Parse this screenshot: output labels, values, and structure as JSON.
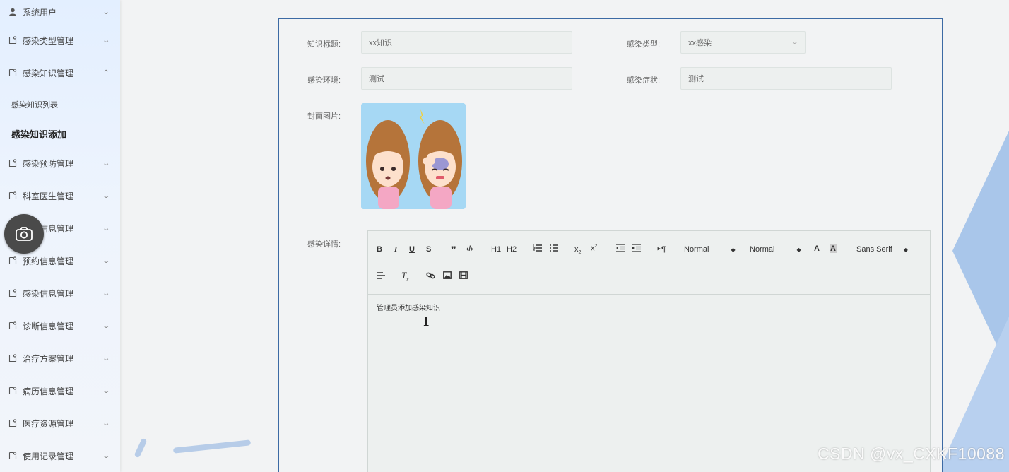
{
  "sidebar": {
    "items": [
      {
        "label": "系统用户",
        "icon": "user-icon"
      },
      {
        "label": "感染类型管理",
        "icon": "doc-icon"
      },
      {
        "label": "感染知识管理",
        "icon": "doc-icon",
        "expanded": true
      },
      {
        "label": "感染预防管理",
        "icon": "doc-icon"
      },
      {
        "label": "科室医生管理",
        "icon": "doc-icon"
      },
      {
        "label": "病房信息管理",
        "icon": "doc-icon"
      },
      {
        "label": "预约信息管理",
        "icon": "doc-icon"
      },
      {
        "label": "感染信息管理",
        "icon": "doc-icon"
      },
      {
        "label": "诊断信息管理",
        "icon": "doc-icon"
      },
      {
        "label": "治疗方案管理",
        "icon": "doc-icon"
      },
      {
        "label": "病历信息管理",
        "icon": "doc-icon"
      },
      {
        "label": "医疗资源管理",
        "icon": "doc-icon"
      },
      {
        "label": "使用记录管理",
        "icon": "doc-icon"
      }
    ],
    "sub_items": [
      {
        "label": "感染知识列表"
      },
      {
        "label": "感染知识添加",
        "active": true
      }
    ]
  },
  "form": {
    "title_label": "知识标题:",
    "title_value": "xx知识",
    "type_label": "感染类型:",
    "type_value": "xx感染",
    "env_label": "感染环境:",
    "env_value": "测试",
    "symptom_label": "感染症状:",
    "symptom_value": "测试",
    "cover_label": "封面图片:",
    "detail_label": "感染详情:"
  },
  "editor": {
    "toolbar": {
      "header1": "H1",
      "header2": "H2",
      "size_select": "Normal",
      "header_select": "Normal",
      "font_select": "Sans Serif"
    },
    "content": "管理员添加感染知识"
  },
  "watermark": "CSDN @vx_CXKF10088",
  "colors": {
    "panel_border": "#3d6aa4",
    "sidebar_bg": "#e3efff",
    "accent_shape": "#a9c6ea"
  }
}
